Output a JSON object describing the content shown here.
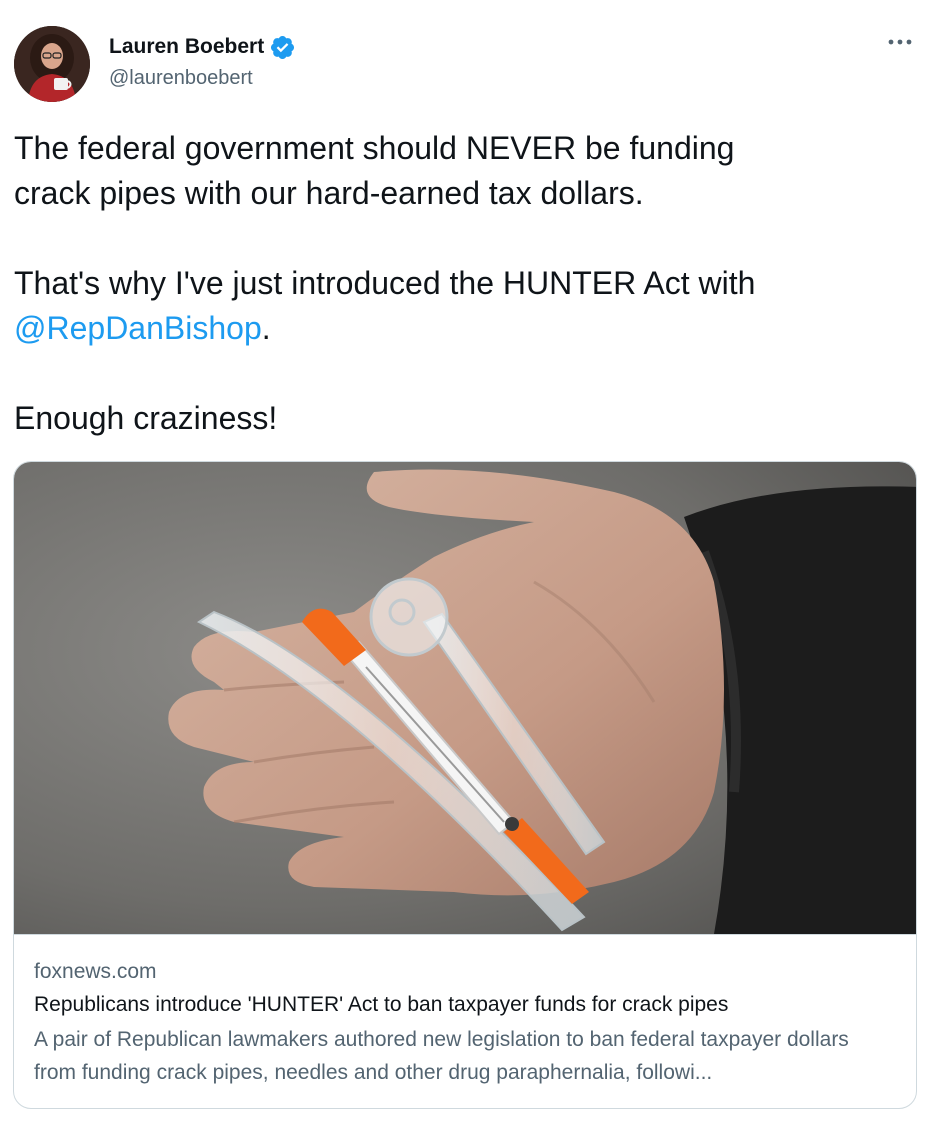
{
  "author": {
    "display_name": "Lauren Boebert",
    "handle": "@laurenboebert",
    "verified": true
  },
  "tweet": {
    "paragraphs": [
      {
        "line1": "The federal government should NEVER be funding",
        "line2": "crack pipes with our hard-earned tax dollars."
      },
      {
        "line1": "That's why I've just introduced the HUNTER Act with",
        "mention": "@RepDanBishop",
        "after_mention": "."
      },
      {
        "line1": "Enough craziness!"
      }
    ]
  },
  "card": {
    "domain": "foxnews.com",
    "title": "Republicans introduce 'HUNTER' Act to ban taxpayer funds for crack pipes",
    "description": "A pair of Republican lawmakers authored new legislation to ban federal taxpayer dollars from funding crack pipes, needles and other drug paraphernalia, followi..."
  },
  "icons": {
    "verified_badge": "verified-badge-icon",
    "more": "more-options-icon"
  },
  "colors": {
    "link": "#1d9bf0",
    "secondary_text": "#536471",
    "border": "#cfd9de",
    "syringe_cap": "#f26a1b"
  }
}
